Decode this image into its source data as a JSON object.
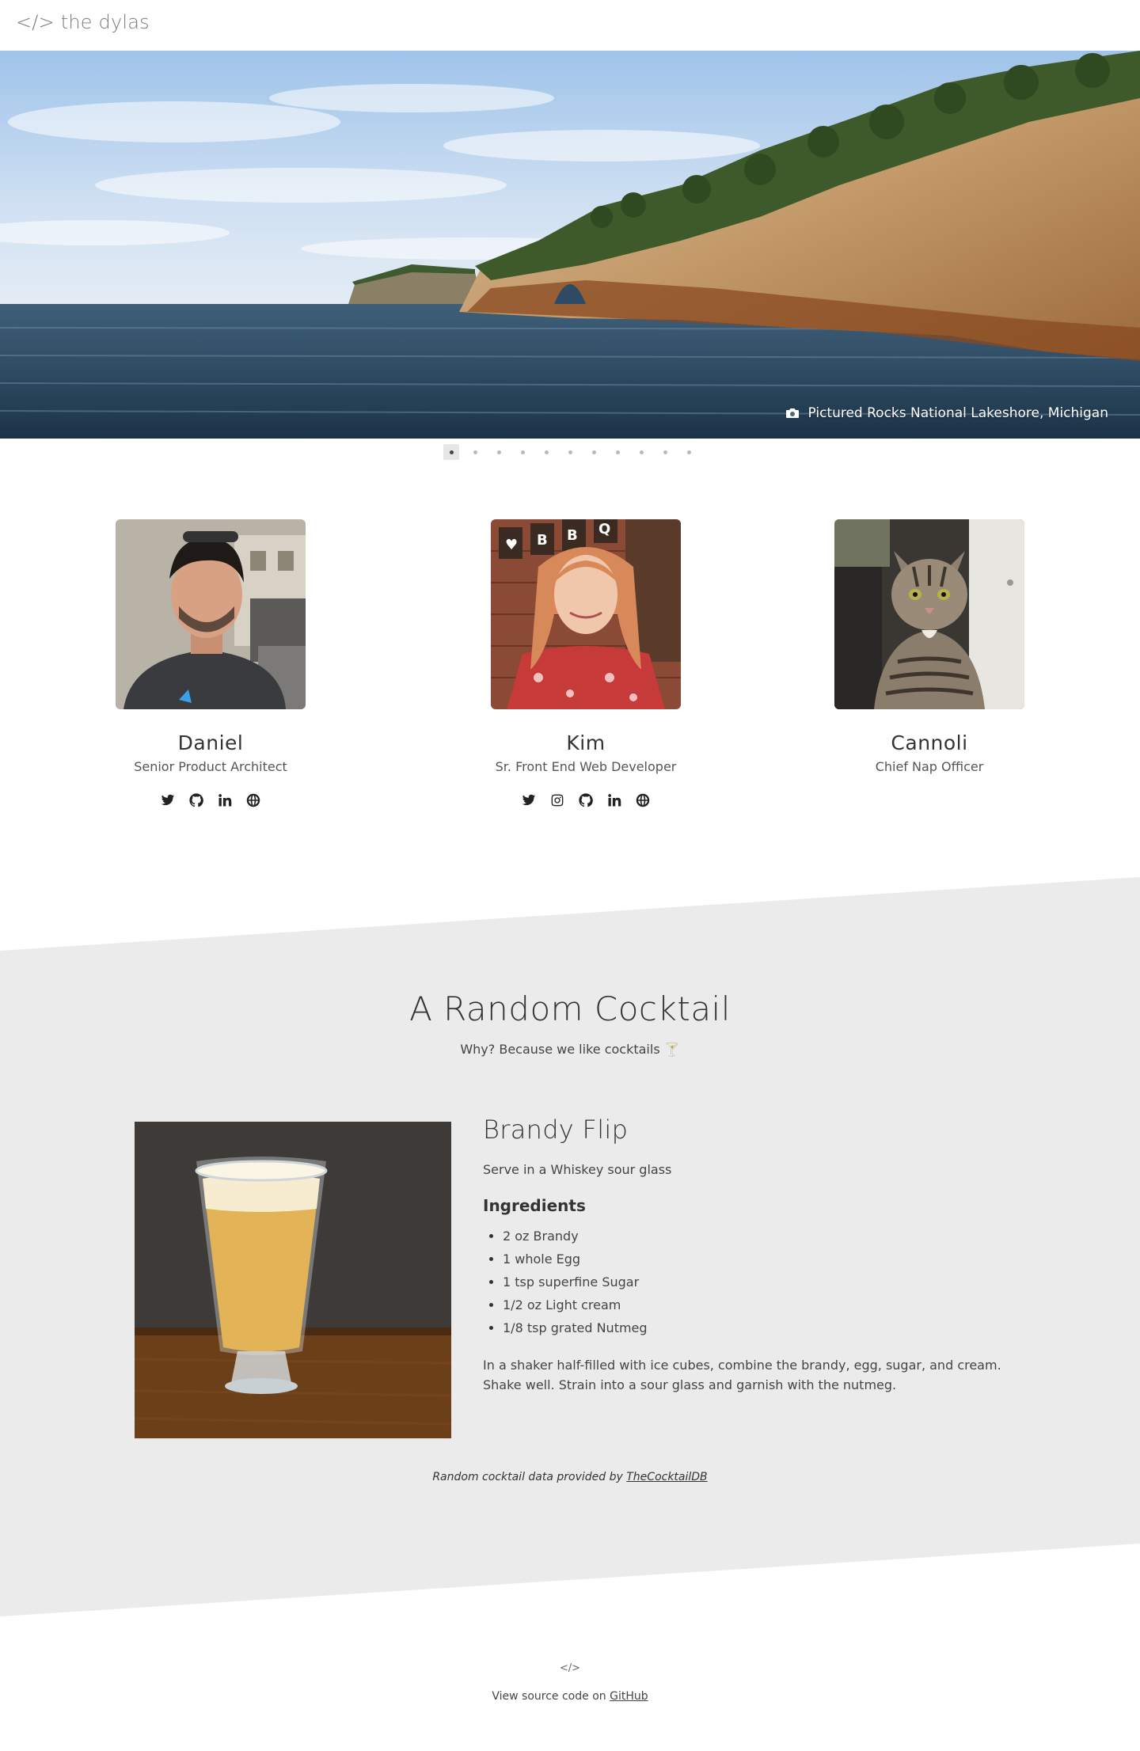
{
  "header": {
    "logo": "</> the dylas"
  },
  "hero": {
    "caption": "Pictured Rocks National Lakeshore, Michigan",
    "caption_icon": "camera-icon",
    "slide_count": 11,
    "active_slide": 1
  },
  "team": [
    {
      "name": "Daniel",
      "role": "Senior Product Architect",
      "socials": [
        "twitter-icon",
        "github-icon",
        "linkedin-icon",
        "globe-icon"
      ]
    },
    {
      "name": "Kim",
      "role": "Sr. Front End Web Developer",
      "socials": [
        "twitter-icon",
        "instagram-icon",
        "github-icon",
        "linkedin-icon",
        "globe-icon"
      ]
    },
    {
      "name": "Cannoli",
      "role": "Chief Nap Officer",
      "socials": []
    }
  ],
  "cocktail": {
    "section_title": "A Random Cocktail",
    "subtitle": "Why? Because we like cocktails 🍸",
    "name": "Brandy Flip",
    "glass": "Serve in a Whiskey sour glass",
    "ingredients_heading": "Ingredients",
    "ingredients": [
      "2 oz Brandy",
      "1 whole Egg",
      "1 tsp superfine Sugar",
      "1/2 oz Light cream",
      "1/8 tsp grated Nutmeg"
    ],
    "instructions": "In a shaker half-filled with ice cubes, combine the brandy, egg, sugar, and cream. Shake well. Strain into a sour glass and garnish with the nutmeg.",
    "credit_prefix": "Random cocktail data provided by ",
    "credit_link": "TheCocktailDB"
  },
  "footer": {
    "logo": "</>",
    "source_prefix": "View source code on ",
    "source_link": "GitHub"
  },
  "colors": {
    "section_bg": "#ebebeb",
    "text": "#333333",
    "logo": "#7a7a7a"
  }
}
